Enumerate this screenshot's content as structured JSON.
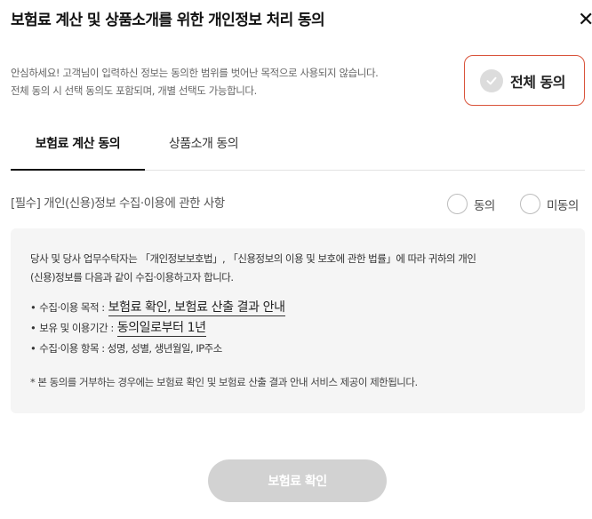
{
  "header": {
    "title": "보험료 계산 및 상품소개를 위한 개인정보 처리 동의",
    "close_icon": "close-icon",
    "close_glyph": "✕"
  },
  "notice": {
    "line1": "안심하세요! 고객님이 입력하신 정보는 동의한 범위를 벗어난 목적으로 사용되지 않습니다.",
    "line2": "전체 동의 시 선택 동의도 포함되며, 개별 선택도 가능합니다."
  },
  "all_agree": {
    "label": "전체 동의",
    "icon": "check-icon",
    "border_color": "#d9533a"
  },
  "tabs": [
    {
      "label": "보험료 계산 동의",
      "active": true
    },
    {
      "label": "상품소개 동의",
      "active": false
    }
  ],
  "section": {
    "title": "[필수] 개인(신용)정보 수집·이용에 관한 사항",
    "agree_label": "동의",
    "disagree_label": "미동의"
  },
  "content": {
    "intro_line1": "당사 및 당사 업무수탁자는 「개인정보보호법」, 「신용정보의 이용 및 보호에 관한 법률」에 따라 귀하의 개인",
    "intro_line2": "(신용)정보를 다음과 같이 수집·이용하고자 합니다.",
    "items": [
      {
        "bullet": "•",
        "label": "수집·이용 목적 :",
        "value": "보험료 확인, 보험료 산출 결과 안내"
      },
      {
        "bullet": "•",
        "label": "보유 및 이용기간 :",
        "value": "동의일로부터 1년"
      },
      {
        "bullet": "•",
        "label": "수집·이용 항목 : 성명, 성별, 생년월일, IP주소"
      }
    ],
    "footnote": "* 본 동의를 거부하는 경우에는 보험료 확인 및 보험료 산출 결과 안내 서비스 제공이 제한됩니다."
  },
  "confirm_button": {
    "label": "보험료 확인",
    "background": "#d2d2d2"
  }
}
